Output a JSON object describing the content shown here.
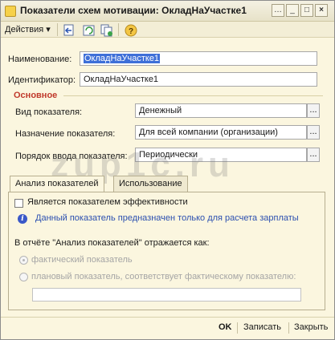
{
  "window": {
    "title": "Показатели схем мотивации: ОкладНаУчастке1",
    "controls": {
      "menu": "…",
      "minimize": "_",
      "maximize": "□",
      "close": "×"
    }
  },
  "toolbar": {
    "actions_label": "Действия",
    "actions_arrow": "▾",
    "icons": [
      "record-back-icon",
      "reread-icon",
      "copy-icon",
      "help-icon"
    ],
    "help_glyph": "?"
  },
  "form": {
    "name_label": "Наименование:",
    "name_value": "ОкладНаУчастке1",
    "id_label": "Идентификатор:",
    "id_value": "ОкладНаУчастке1",
    "group_title": "Основное",
    "type_label": "Вид показателя:",
    "type_value": "Денежный",
    "purpose_label": "Назначение показателя:",
    "purpose_value": "Для всей компании (организации)",
    "order_label": "Порядок ввода показателя:",
    "order_value": "Периодически",
    "dots": "..."
  },
  "tabs": [
    {
      "label": "Анализ показателей",
      "active": true
    },
    {
      "label": "Использование",
      "active": false
    }
  ],
  "analysis": {
    "efficiency_checkbox_label": "Является показателем эффективности",
    "efficiency_checked": false,
    "info_text": "Данный показатель предназначен только для расчета зарплаты",
    "report_text": "В отчёте \"Анализ показателей\" отражается как:",
    "radio_actual": "фактический показатель",
    "radio_planned": "плановый показатель, соответствует фактическому показателю:",
    "selected_radio": "actual",
    "planned_field_value": "",
    "mini_buttons": [
      "...",
      "×",
      "🔍"
    ]
  },
  "watermark": "zup1c.ru",
  "buttons": {
    "ok": "OK",
    "save": "Записать",
    "close": "Закрыть"
  }
}
